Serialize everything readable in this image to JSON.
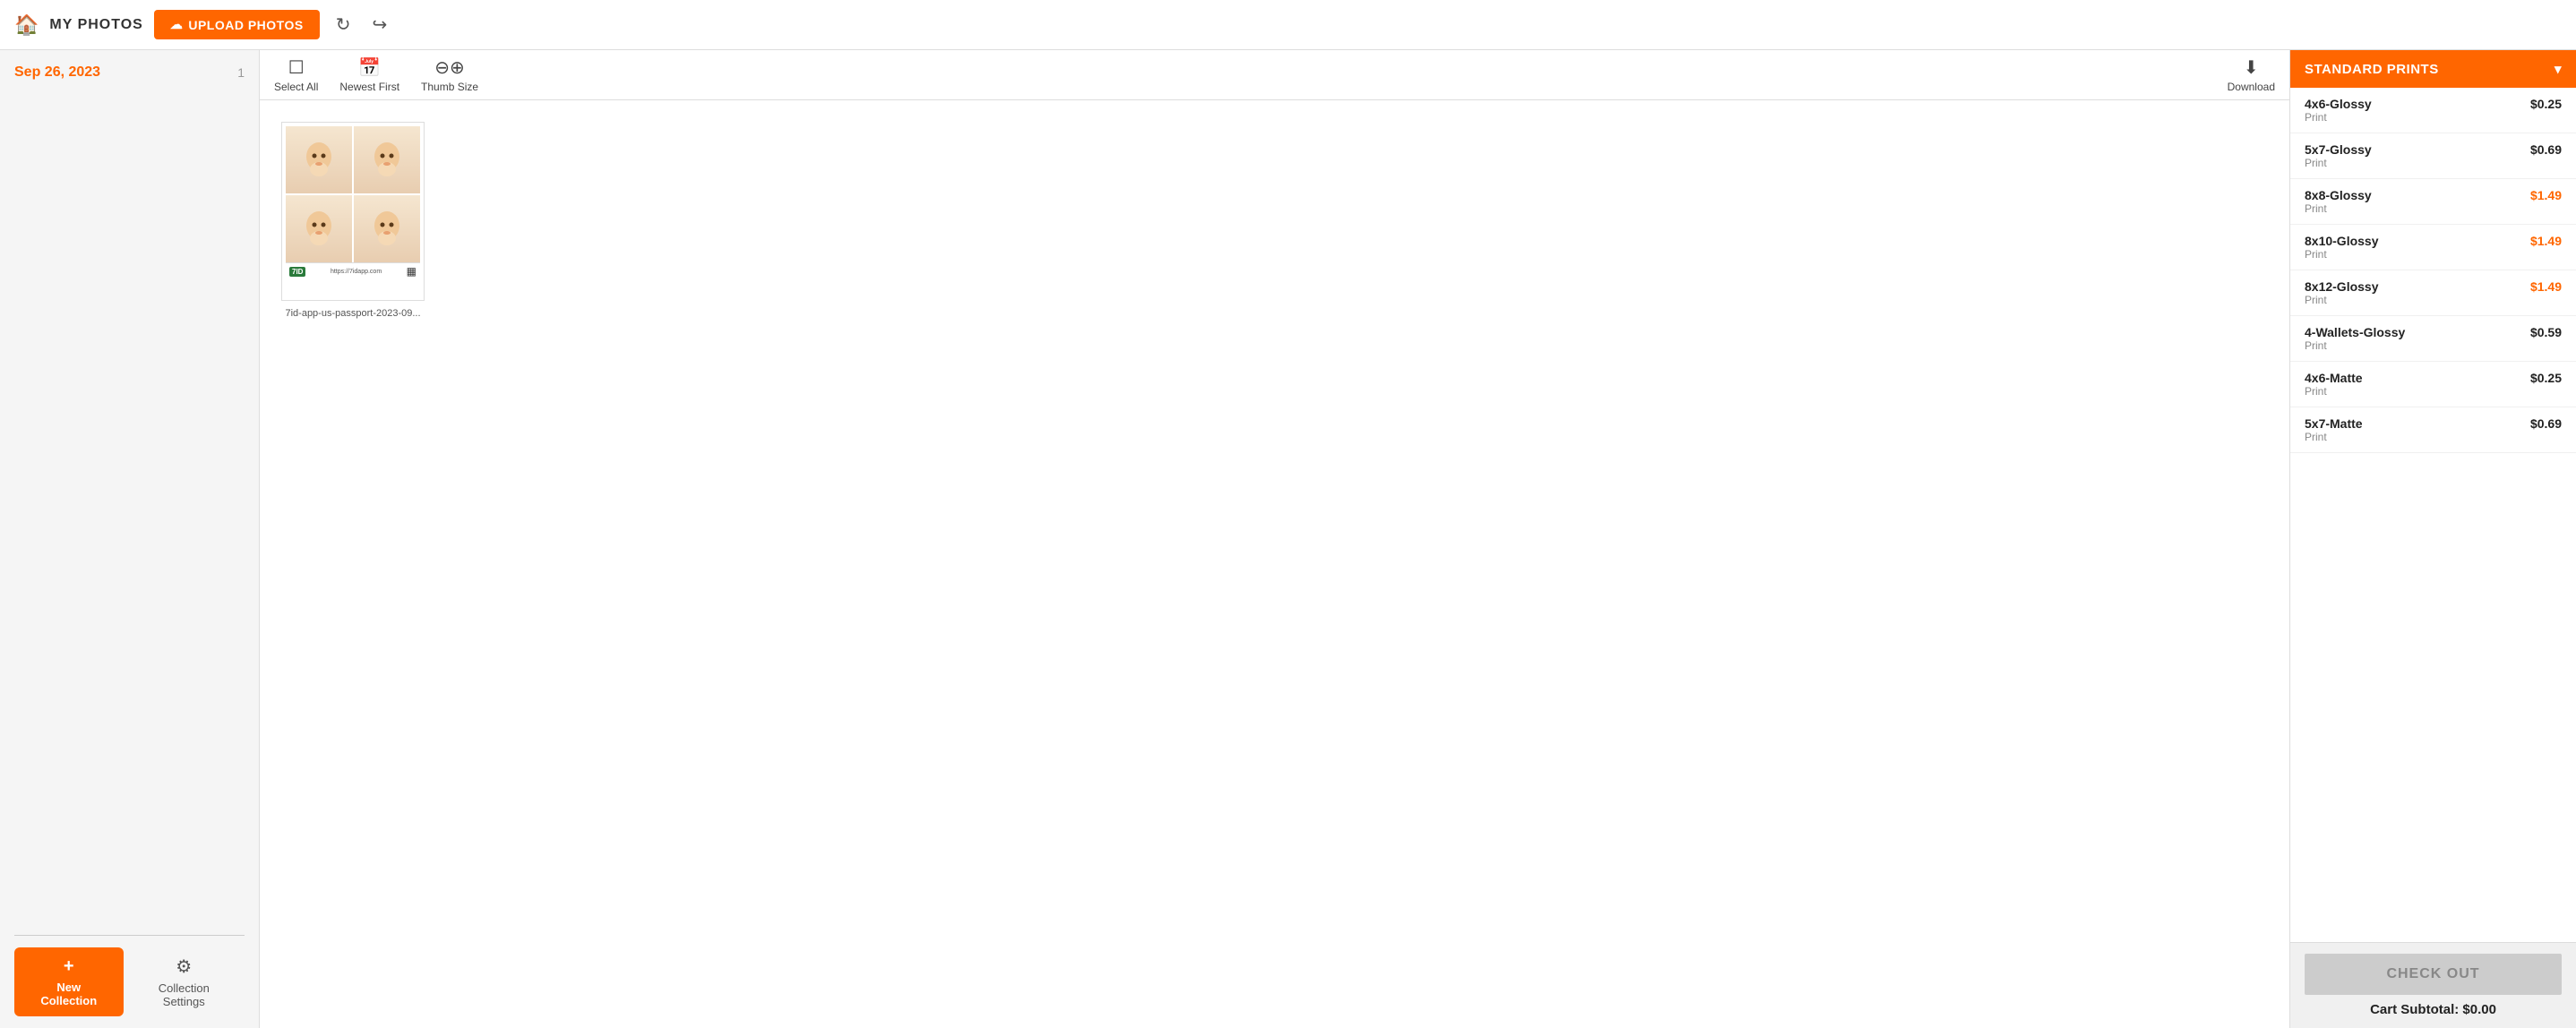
{
  "topbar": {
    "my_photos_label": "MY PHOTOS",
    "upload_btn_label": "UPLOAD PHOTOS",
    "refresh_icon": "↻",
    "share_icon": "↪"
  },
  "left_sidebar": {
    "date_label": "Sep 26, 2023",
    "date_count": "1",
    "new_collection_plus": "+",
    "new_collection_label": "New Collection",
    "collection_settings_label": "Collection Settings"
  },
  "toolbar": {
    "select_all_label": "Select All",
    "newest_first_label": "Newest First",
    "thumb_size_label": "Thumb Size",
    "download_label": "Download"
  },
  "photo": {
    "filename": "7id-app-us-passport-2023-09...",
    "logo_text": "7ID",
    "logo_url": "https://7idapp.com"
  },
  "right_sidebar": {
    "standard_prints_label": "STANDARD PRINTS",
    "chevron": "▾",
    "prints": [
      {
        "name": "4x6-Glossy",
        "type": "Print",
        "price": "$0.25",
        "highlighted": false
      },
      {
        "name": "5x7-Glossy",
        "type": "Print",
        "price": "$0.69",
        "highlighted": false
      },
      {
        "name": "8x8-Glossy",
        "type": "Print",
        "price": "$1.49",
        "highlighted": true
      },
      {
        "name": "8x10-Glossy",
        "type": "Print",
        "price": "$1.49",
        "highlighted": true
      },
      {
        "name": "8x12-Glossy",
        "type": "Print",
        "price": "$1.49",
        "highlighted": true
      },
      {
        "name": "4-Wallets-Glossy",
        "type": "Print",
        "price": "$0.59",
        "highlighted": false
      },
      {
        "name": "4x6-Matte",
        "type": "Print",
        "price": "$0.25",
        "highlighted": false
      },
      {
        "name": "5x7-Matte",
        "type": "Print",
        "price": "$0.69",
        "highlighted": false
      }
    ],
    "checkout_label": "CHECK OUT",
    "cart_subtotal": "Cart Subtotal: $0.00"
  }
}
